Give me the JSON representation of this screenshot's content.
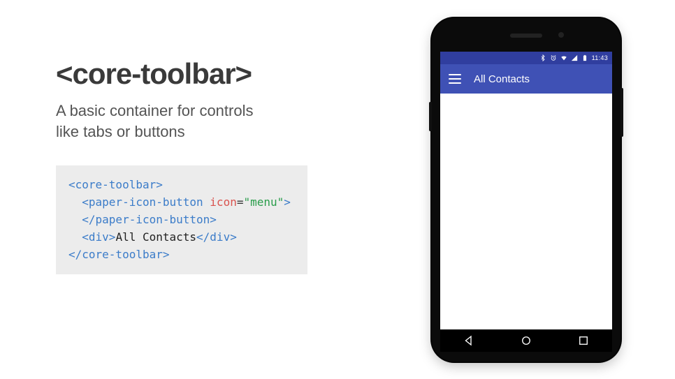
{
  "heading": "<core-toolbar>",
  "subtitle_line1": "A basic container for controls",
  "subtitle_line2": "like tabs or buttons",
  "code": {
    "l1a": "<core-toolbar>",
    "l2a": "  <paper-icon-button",
    "l2_space": " ",
    "l2_attr": "icon",
    "l2_eq": "=",
    "l2_val": "\"menu\"",
    "l2b": ">",
    "l3": "  </paper-icon-button>",
    "l4a": "  <div>",
    "l4_text": "All Contacts",
    "l4b": "</div>",
    "l5": "</core-toolbar>"
  },
  "phone": {
    "status": {
      "time": "11:43"
    },
    "toolbar": {
      "title": "All Contacts"
    }
  }
}
